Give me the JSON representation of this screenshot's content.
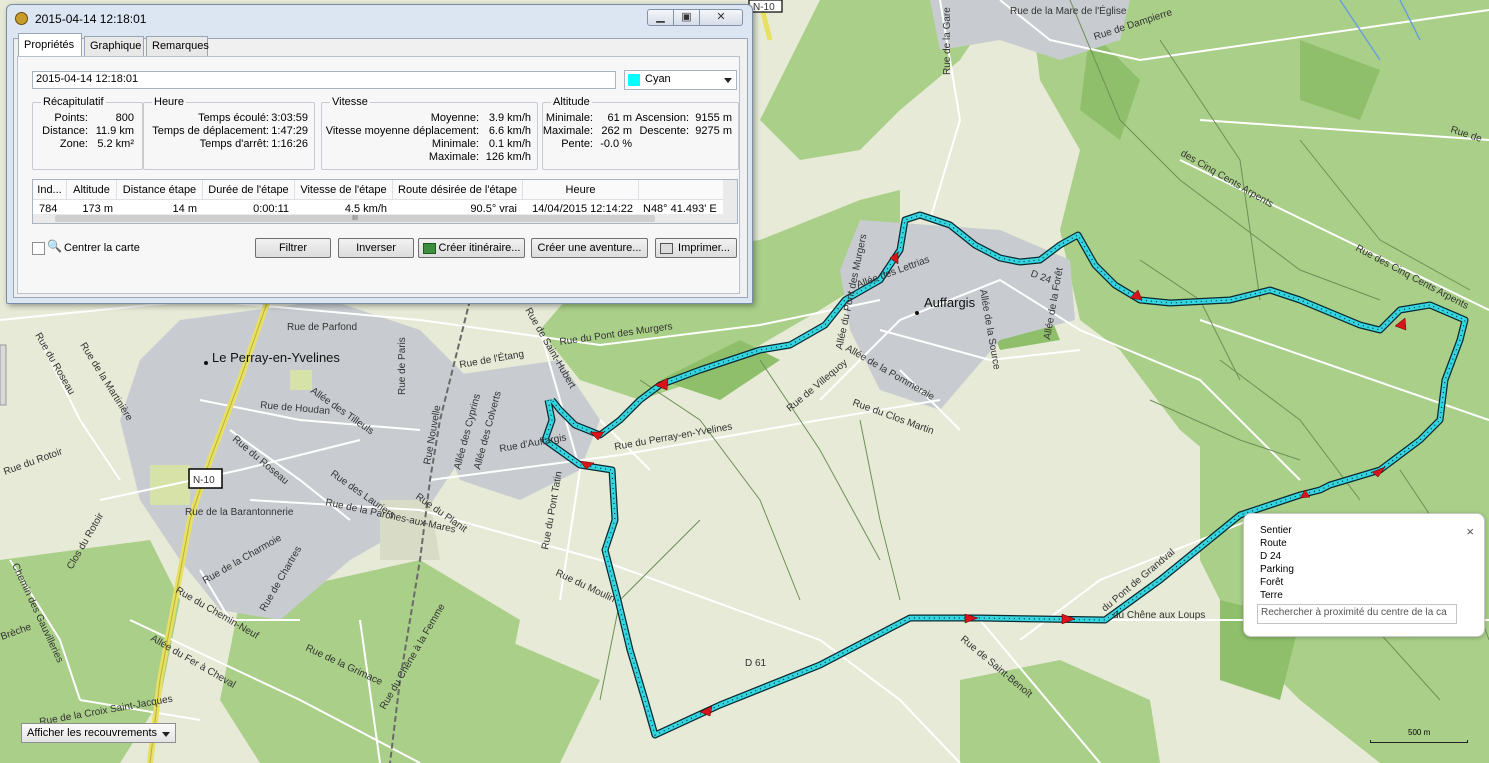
{
  "window": {
    "title": "2015-04-14 12:18:01",
    "tabs": [
      "Propriétés",
      "Graphique",
      "Remarques"
    ],
    "name_value": "2015-04-14 12:18:01",
    "color_value": "Cyan",
    "summary": {
      "title": "Récapitulatif",
      "points_label": "Points:",
      "points_value": "800",
      "distance_label": "Distance:",
      "distance_value": "11.9 km",
      "zone_label": "Zone:",
      "zone_value": "5.2 km²"
    },
    "hour": {
      "title": "Heure",
      "elapsed_label": "Temps écoulé:",
      "elapsed_value": "3:03:59",
      "moving_label": "Temps de déplacement:",
      "moving_value": "1:47:29",
      "stopped_label": "Temps d'arrêt:",
      "stopped_value": "1:16:26"
    },
    "speed": {
      "title": "Vitesse",
      "avg_label": "Moyenne:",
      "avg_value": "3.9 km/h",
      "avg_moving_label": "Vitesse moyenne déplacement:",
      "avg_moving_value": "6.6 km/h",
      "min_label": "Minimale:",
      "min_value": "0.1 km/h",
      "max_label": "Maximale:",
      "max_value": "126 km/h"
    },
    "altitude": {
      "title": "Altitude",
      "min_label": "Minimale:",
      "min_value": "61 m",
      "max_label": "Maximale:",
      "max_value": "262 m",
      "slope_label": "Pente:",
      "slope_value": "-0.0 %",
      "ascent_label": "Ascension:",
      "ascent_value": "9155 m",
      "descent_label": "Descente:",
      "descent_value": "9275 m"
    },
    "table": {
      "headers": [
        "Ind...",
        "Altitude",
        "Distance étape",
        "Durée de l'étape",
        "Vitesse de l'étape",
        "Route désirée de l'étape",
        "Heure",
        ""
      ],
      "row": [
        "784",
        "173 m",
        "14 m",
        "0:00:11",
        "4.5 km/h",
        "90.5° vrai",
        "14/04/2015 12:14:22",
        "N48° 41.493' E"
      ],
      "scroll_glyph": "III"
    },
    "center_map_label": "Centrer la carte",
    "buttons": {
      "filter": "Filtrer",
      "invert": "Inverser",
      "create_route": "Créer itinéraire...",
      "create_adventure": "Créer une aventure...",
      "print": "Imprimer..."
    }
  },
  "popup": {
    "items": [
      "Sentier",
      "Route",
      "D 24",
      "Parking",
      "Forêt",
      "Terre"
    ],
    "search_placeholder": "Rechercher à proximité du centre de la ca",
    "close": "×"
  },
  "overlays_button": "Afficher les recouvrements",
  "scale": "500 m",
  "map": {
    "track_color": "#33d6e0",
    "places": [
      "Auffargis",
      "Le Perray-en-Yvelines"
    ],
    "road_shields": [
      "N-10"
    ],
    "labels": {
      "n10_top": "N-10",
      "mare_eglise": "Rue de la Mare de l'Église",
      "dampierre": "Rue de Dampierre",
      "de_la_gare": "Rue de la Gare",
      "cinq_cents_1": "des Cinq Cents Arpents",
      "cinq_cents_2": "Rue des Cinq Cents Arpents",
      "rue_de_right": "Rue de",
      "parfond": "Rue de Parfond",
      "pont_murgers": "Rue du Pont des Murgers",
      "etang": "Rue de l'Étang",
      "saint_hubert": "Rue de Saint-Hubert",
      "perray": "Rue du Perray-en-Yvelines",
      "auffargis_rue": "Rue d'Auffargis",
      "villequoy": "Rue de Villequoy",
      "pommeraie": "Allée de la Pommeraie",
      "clos_martin": "Rue du Clos Martin",
      "allee_lettrias": "Allée des Lettrias",
      "source": "Allée de la Source",
      "d24": "D 24",
      "foret": "Allée de la Forêt",
      "murgers_allee": "Allée du Pont des Murgers",
      "roseau": "Rue du Roseau",
      "martiniere": "Rue de la Martinière",
      "rotoir": "Rue du Rotoir",
      "clos_rotoir": "Clos du Rotoir",
      "houdan": "Rue de Houdan",
      "tilleuls": "Allée des Tilleuls",
      "paris": "Rue de Paris",
      "nouvelle": "Rue Nouvelle",
      "cyprins": "Allée des Cyprins",
      "colverts": "Allée des Colverts",
      "roseau2": "Rue du Roseau",
      "lauriers": "Rue des Lauriers",
      "planit": "Rue du Planit",
      "barantonnerie": "Rue de la Barantonnerie",
      "parches": "Rue de la Parches-aux-Mares",
      "pont_tatin": "Rue du Pont Tatin",
      "charmoie": "Rue de la Charmoie",
      "chemin_neuf": "Rue du Chemin-Neuf",
      "chartres": "Rue de Chartres",
      "gauvilleries": "Chemin des Gauvilleries",
      "fer_cheval": "Allée du Fer à Cheval",
      "grimace": "Rue de la Grimace",
      "chene_femme": "Rue du Chêne à la Femme",
      "croix": "Rue de la Croix Saint-Jacques",
      "moulin": "Rue du Moulin",
      "d61": "D 61",
      "saint_benoit": "Rue de Saint-Benoît",
      "chene_loups": "du Chêne aux Loups",
      "pont_grandval": "du Pont de Grandval",
      "breche": "Brèche"
    }
  }
}
